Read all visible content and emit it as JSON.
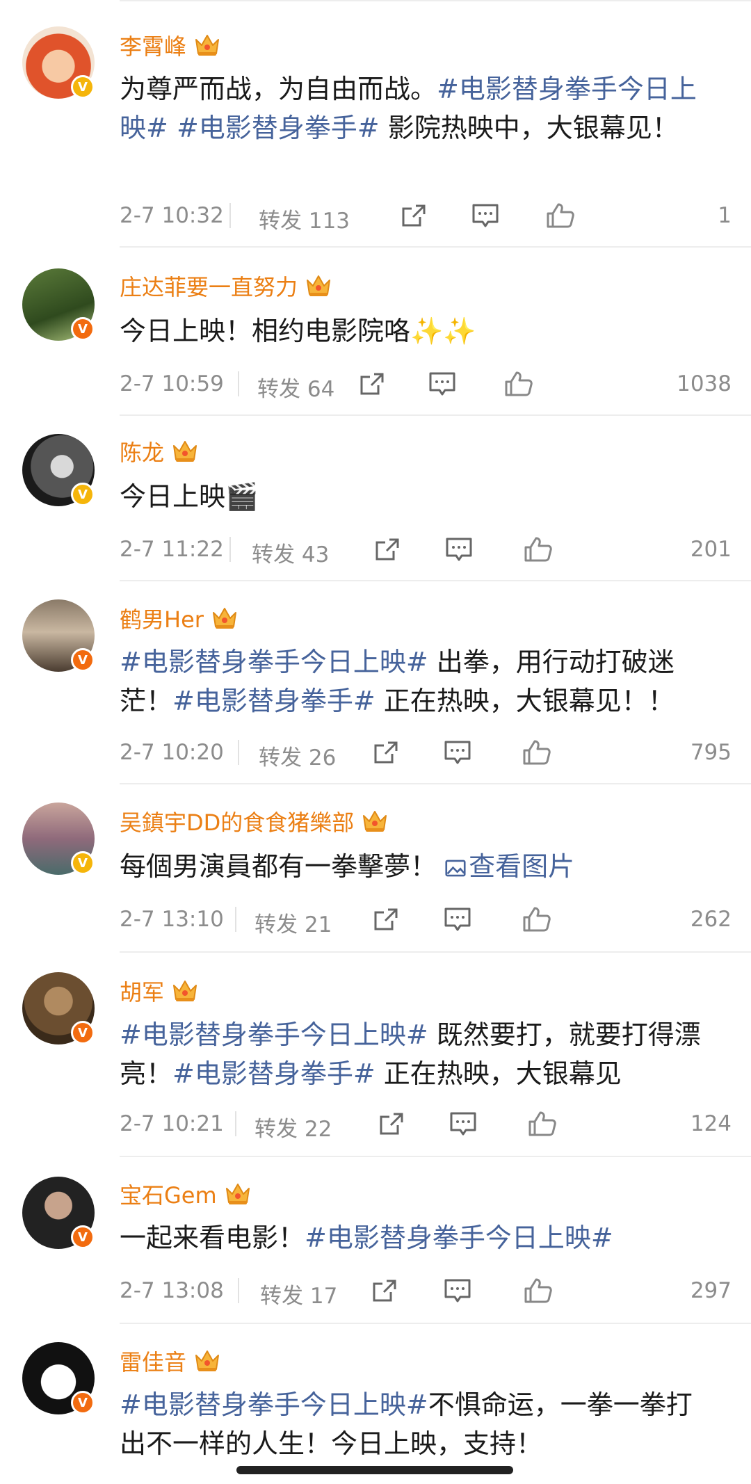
{
  "posts": [
    {
      "name": "李霄峰",
      "badge": "gold",
      "content": [
        {
          "t": "为尊严而战，为自由而战。"
        },
        {
          "t": "#电影替身拳手今日上映#",
          "c": "tag"
        },
        {
          "t": " "
        },
        {
          "t": "#电影替身拳手#",
          "c": "tag"
        },
        {
          "t": " 影院热映中，大银幕见！"
        }
      ],
      "time": "2-7 10:32",
      "repost": "转发 113",
      "likes": "1"
    },
    {
      "name": "庄达菲要一直努力",
      "badge": "orange",
      "content": [
        {
          "t": "今日上映！相约电影院咯✨✨"
        }
      ],
      "time": "2-7 10:59",
      "repost": "转发 64",
      "likes": "1038"
    },
    {
      "name": "陈龙",
      "badge": "gold",
      "content": [
        {
          "t": "今日上映🎬"
        }
      ],
      "time": "2-7 11:22",
      "repost": "转发 43",
      "likes": "201"
    },
    {
      "name": "鹤男Her",
      "badge": "orange",
      "content": [
        {
          "t": "#电影替身拳手今日上映#",
          "c": "tag"
        },
        {
          "t": " 出拳，用行动打破迷茫！"
        },
        {
          "t": "#电影替身拳手#",
          "c": "tag"
        },
        {
          "t": " 正在热映，大银幕见！！"
        }
      ],
      "time": "2-7 10:20",
      "repost": "转发 26",
      "likes": "795"
    },
    {
      "name": "吴鎮宇DD的食食猪樂部",
      "badge": "gold",
      "content": [
        {
          "t": "每個男演員都有一拳擊夢！ "
        },
        {
          "t": "查看图片",
          "c": "link",
          "img": true
        }
      ],
      "time": "2-7 13:10",
      "repost": "转发 21",
      "likes": "262"
    },
    {
      "name": "胡军",
      "badge": "orange",
      "content": [
        {
          "t": "#电影替身拳手今日上映#",
          "c": "tag"
        },
        {
          "t": " 既然要打，就要打得漂亮！"
        },
        {
          "t": "#电影替身拳手#",
          "c": "tag"
        },
        {
          "t": " 正在热映，大银幕见"
        }
      ],
      "time": "2-7 10:21",
      "repost": "转发 22",
      "likes": "124"
    },
    {
      "name": "宝石Gem",
      "badge": "orange",
      "content": [
        {
          "t": "一起来看电影！"
        },
        {
          "t": "#电影替身拳手今日上映#",
          "c": "tag"
        }
      ],
      "time": "2-7 13:08",
      "repost": "转发 17",
      "likes": "297"
    },
    {
      "name": "雷佳音",
      "badge": "orange",
      "content": [
        {
          "t": "#电影替身拳手今日上映#",
          "c": "tag"
        },
        {
          "t": "不惧命运，一拳一拳打出不一样的人生！今日上映，支持！"
        }
      ],
      "time": "",
      "repost": "",
      "likes": ""
    }
  ],
  "colors": {
    "name": "#eb7f14",
    "hashtag": "#46639b",
    "meta": "#8c8c8c"
  },
  "icons": [
    "crown-icon",
    "verified-icon",
    "share-icon",
    "comment-icon",
    "like-icon",
    "image-icon"
  ]
}
